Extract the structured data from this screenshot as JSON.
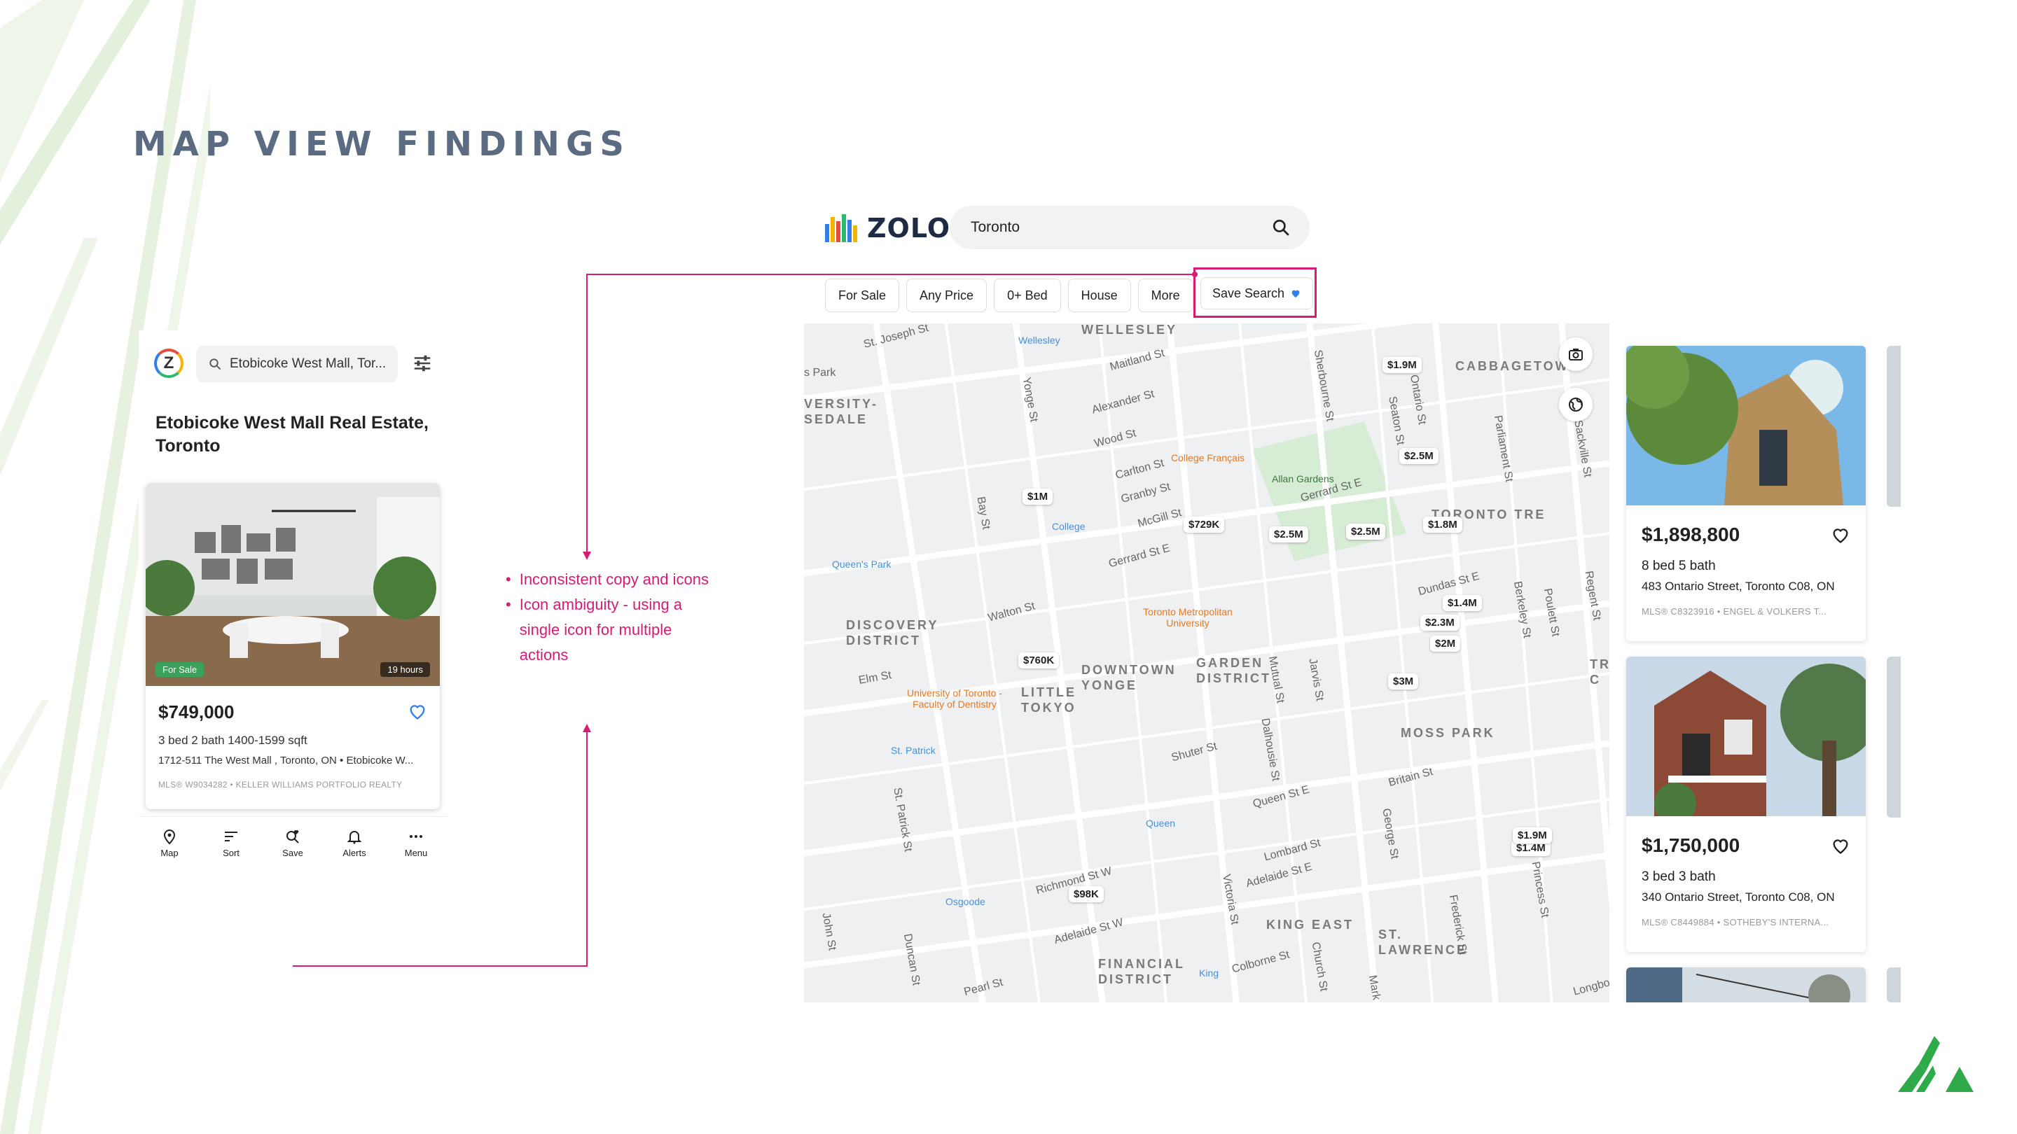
{
  "slide": {
    "title": "MAP VIEW FINDINGS",
    "colors": {
      "title": "#5a6b82",
      "accent": "#d81b73",
      "brand_green": "#2eaa4a"
    }
  },
  "mobile": {
    "search_text": "Etobicoke West Mall, Tor...",
    "heading": "Etobicoke West Mall Real Estate, Toronto",
    "card": {
      "badge_status": "For Sale",
      "badge_time": "19 hours",
      "price": "$749,000",
      "specs": "3 bed  2 bath  1400-1599 sqft",
      "address": "1712-511 The West Mall , Toronto, ON • Etobicoke W...",
      "mls": "MLS® W9034282 • KELLER WILLIAMS PORTFOLIO REALTY"
    },
    "nav": [
      {
        "label": "Map",
        "icon": "map-pin-icon"
      },
      {
        "label": "Sort",
        "icon": "sort-icon"
      },
      {
        "label": "Save",
        "icon": "save-search-icon"
      },
      {
        "label": "Alerts",
        "icon": "bell-icon"
      },
      {
        "label": "Menu",
        "icon": "more-icon"
      }
    ]
  },
  "annotation": {
    "bullets": [
      "Inconsistent copy and icons",
      "Icon ambiguity - using a single icon for multiple actions"
    ]
  },
  "desktop": {
    "logo_text": "ZOLO",
    "search_value": "Toronto",
    "filters": [
      "For Sale",
      "Any Price",
      "0+ Bed",
      "House",
      "More"
    ],
    "save_search": "Save Search",
    "map": {
      "streets": [
        "St. Joseph St",
        "Wellesley",
        "WELLESLEY",
        "Maitland St",
        "Sherbourne St",
        "Seaton St",
        "Ontario St",
        "Parliament St",
        "Sackville St",
        "Alexander St",
        "Wood St",
        "Carlton St",
        "Granby St",
        "McGill St",
        "Gerrard St E",
        "Bay St",
        "Yonge St",
        "Walton St",
        "Elm St",
        "Dundas St E",
        "Berkeley St",
        "Poulett St",
        "Regent St",
        "Mutual St",
        "Jarvis St",
        "Dalhousie St",
        "Shuter St",
        "Queen St E",
        "Britain St",
        "George St",
        "Lombard St",
        "Adelaide St E",
        "Victoria St",
        "Richmond St W",
        "Adelaide St W",
        "Colborne St",
        "Church St",
        "Frederick St",
        "Princess St",
        "Pearl St",
        "John St",
        "Duncan St",
        "St. Patrick St",
        "Longbo",
        "Mark"
      ],
      "districts": [
        "CABBAGETOWN",
        "TORONTO TRE",
        "DISCOVERY DISTRICT",
        "DOWNTOWN YONGE",
        "GARDEN DISTRICT",
        "LITTLE TOKYO",
        "MOSS PARK",
        "KING EAST",
        "ST. LAWRENCE",
        "FINANCIAL DISTRICT",
        "VERSITY- SEDALE",
        "s Park",
        "TR C"
      ],
      "pois": [
        "Wellesley",
        "College Français",
        "Allan Gardens",
        "College",
        "Queen's Park",
        "Toronto Metropolitan University",
        "University of Toronto - Faculty of Dentistry",
        "St. Patrick",
        "Queen",
        "Osgoode",
        "King"
      ],
      "prices": [
        "$1.9M",
        "$2.5M",
        "$1M",
        "$729K",
        "$2.5M",
        "$2.5M",
        "$1.8M",
        "$1.4M",
        "$2.3M",
        "$2M",
        "$760K",
        "$3M",
        "$1.4M",
        "$98K",
        "$1.9M"
      ]
    },
    "listings": [
      {
        "price": "$1,898,800",
        "specs": "8 bed  5 bath",
        "address": "483 Ontario Street, Toronto C08, ON",
        "mls": "MLS® C8323916 • ENGEL & VOLKERS T..."
      },
      {
        "price": "$1,750,000",
        "specs": "3 bed  3 bath",
        "address": "340 Ontario Street, Toronto C08, ON",
        "mls": "MLS® C8449884 • SOTHEBY'S INTERNA..."
      }
    ]
  }
}
